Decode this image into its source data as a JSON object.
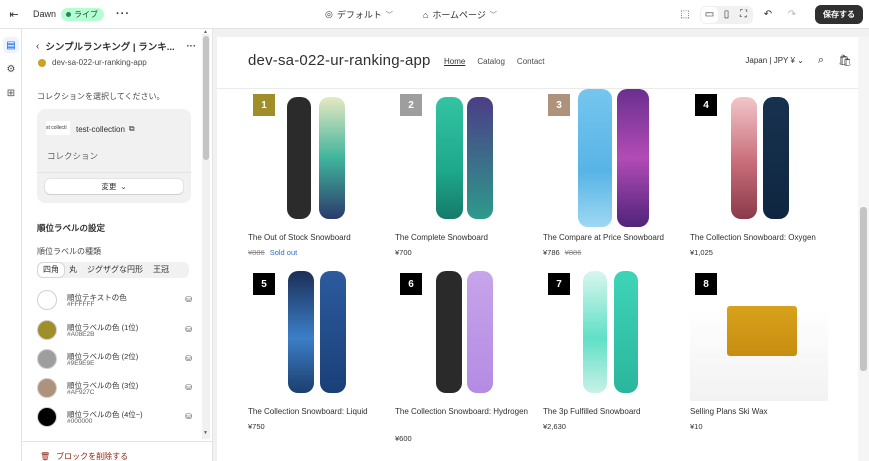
{
  "topbar": {
    "theme_name": "Dawn",
    "live_badge": "ライブ",
    "template_selector": "デフォルト",
    "page_selector": "ホームページ",
    "save_label": "保存する"
  },
  "panel": {
    "header_title": "シンプルランキング | ランキ...",
    "app_name": "dev-sa-022-ur-ranking-app",
    "collection_prompt": "コレクションを選択してください。",
    "collection": {
      "thumb_text": "st collecti",
      "name": "test-collection",
      "type_label": "コレクション",
      "change_label": "変更"
    },
    "rank_settings_title": "順位ラベルの設定",
    "rank_type_label": "順位ラベルの種類",
    "rank_types": [
      "四角",
      "丸",
      "ジグザグな円形",
      "王冠"
    ],
    "swatches": [
      {
        "name": "順位テキストの色",
        "hex": "#FFFFFF",
        "color": "#FFFFFF"
      },
      {
        "name": "順位ラベルの色 (1位)",
        "hex": "#A08E2B",
        "color": "#A08E2B"
      },
      {
        "name": "順位ラベルの色 (2位)",
        "hex": "#9E9E9E",
        "color": "#9E9E9E"
      },
      {
        "name": "順位ラベルの色 (3位)",
        "hex": "#AF927C",
        "color": "#AF927C"
      },
      {
        "name": "順位ラベルの色 (4位~)",
        "hex": "#000000",
        "color": "#000000"
      }
    ],
    "remove_block": "ブロックを削除する"
  },
  "store": {
    "name": "dev-sa-022-ur-ranking-app",
    "nav": [
      "Home",
      "Catalog",
      "Contact"
    ],
    "locale": "Japan | JPY ¥"
  },
  "products": [
    {
      "rank": "1",
      "title": "The Out of Stock Snowboard",
      "price": "¥886",
      "compare_price": "",
      "sold_out": "Sold out",
      "rank_color": "#A08E2B"
    },
    {
      "rank": "2",
      "title": "The Complete Snowboard",
      "price": "¥700",
      "compare_price": "",
      "sold_out": "",
      "rank_color": "#9E9E9E"
    },
    {
      "rank": "3",
      "title": "The Compare at Price Snowboard",
      "price": "¥786",
      "compare_price": "¥886",
      "sold_out": "",
      "rank_color": "#AF927C"
    },
    {
      "rank": "4",
      "title": "The Collection Snowboard: Oxygen",
      "price": "¥1,025",
      "compare_price": "",
      "sold_out": "",
      "rank_color": "#000000"
    },
    {
      "rank": "5",
      "title": "The Collection Snowboard: Liquid",
      "price": "¥750",
      "compare_price": "",
      "sold_out": "",
      "rank_color": "#000000"
    },
    {
      "rank": "6",
      "title": "The Collection Snowboard: Hydrogen",
      "price": "¥600",
      "compare_price": "",
      "sold_out": "",
      "rank_color": "#000000"
    },
    {
      "rank": "7",
      "title": "The 3p Fulfilled Snowboard",
      "price": "¥2,630",
      "compare_price": "",
      "sold_out": "",
      "rank_color": "#000000"
    },
    {
      "rank": "8",
      "title": "Selling Plans Ski Wax",
      "price": "¥10",
      "compare_price": "",
      "sold_out": "",
      "rank_color": "#000000"
    }
  ]
}
